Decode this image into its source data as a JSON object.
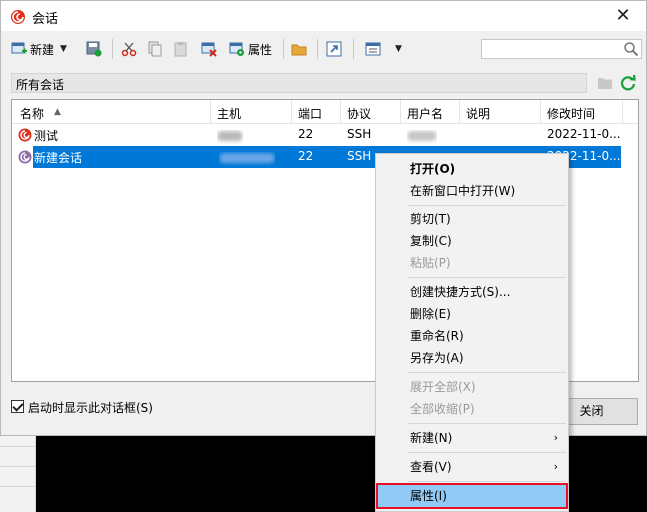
{
  "window": {
    "title": "会话",
    "close_glyph": "✕"
  },
  "toolbar": {
    "new_label": "新建",
    "properties_label": "属性",
    "icons": [
      "new-session-icon",
      "save-session-icon",
      "cut-icon",
      "copy-icon",
      "paste-icon",
      "delete-icon",
      "properties-icon",
      "folder-icon",
      "shortcut-icon",
      "view-icon"
    ]
  },
  "search": {
    "placeholder": ""
  },
  "breadcrumb": {
    "path": "所有会话"
  },
  "columns": [
    "名称",
    "主机",
    "端口",
    "协议",
    "用户名",
    "说明",
    "修改时间"
  ],
  "sort_glyph": "▲",
  "sessions": [
    {
      "name": "测试",
      "port": "22",
      "protocol": "SSH",
      "modified": "2022-11-0...",
      "selected": false
    },
    {
      "name": "新建会话",
      "port": "22",
      "protocol": "SSH",
      "modified": "2022-11-0...",
      "selected": true
    }
  ],
  "footer": {
    "startup_label": "启动时显示此对话框(S)",
    "startup_checked": true,
    "close_label": "关闭"
  },
  "context_menu": {
    "items": [
      {
        "label": "打开(O)",
        "bold": true
      },
      {
        "label": "在新窗口中打开(W)"
      },
      {
        "label": "剪切(T)"
      },
      {
        "label": "复制(C)"
      },
      {
        "label": "粘贴(P)",
        "disabled": true
      },
      {
        "label": "创建快捷方式(S)..."
      },
      {
        "label": "删除(E)"
      },
      {
        "label": "重命名(R)"
      },
      {
        "label": "另存为(A)"
      },
      {
        "label": "展开全部(X)",
        "disabled": true
      },
      {
        "label": "全部收缩(P)",
        "disabled": true
      },
      {
        "label": "新建(N)",
        "submenu": true
      },
      {
        "label": "查看(V)",
        "submenu": true
      },
      {
        "label": "属性(I)",
        "highlighted": true
      }
    ],
    "submenu_glyph": "›"
  },
  "colors": {
    "selection": "#0078d7",
    "menu_highlight": "#91c9f7",
    "highlight_border": "#e81123",
    "refresh_green": "#1a9e3a"
  }
}
